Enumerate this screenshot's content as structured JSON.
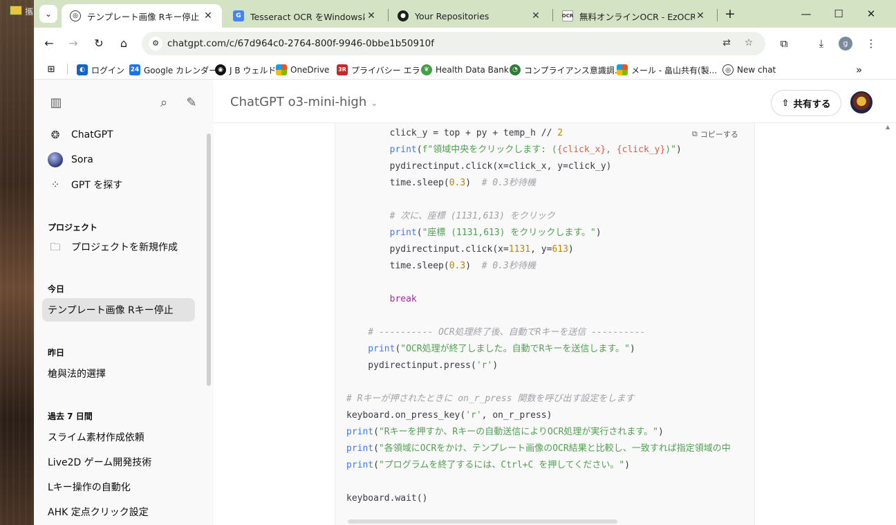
{
  "desktop": {
    "taskbar_label": "攜"
  },
  "tabs": [
    {
      "title": "テンプレート画像 Rキー停止",
      "favicon": "openai-icon",
      "active": true
    },
    {
      "title": "Tesseract OCR をWindowsにインス",
      "favicon": "google-translate-icon",
      "active": false
    },
    {
      "title": "Your Repositories",
      "favicon": "github-icon",
      "active": false
    },
    {
      "title": "無料オンラインOCR - EzOCR",
      "favicon": "ezocr-icon",
      "active": false
    }
  ],
  "toolbar": {
    "url": "chatgpt.com/c/67d964c0-2764-800f-9946-0bbe1b50910f",
    "profile_letter": "g"
  },
  "bookmarks": [
    {
      "label": "ログイン",
      "icon": "globe-icon"
    },
    {
      "label": "Google カレンダー",
      "icon": "calendar-icon",
      "icon_text": "24"
    },
    {
      "label": "J B ウェルド",
      "icon": "jb-icon"
    },
    {
      "label": "OneDrive",
      "icon": "microsoft-icon"
    },
    {
      "label": "プライバシー エラー",
      "icon": "3r-icon",
      "icon_text": "3R"
    },
    {
      "label": "Health Data Bank",
      "icon": "leaf-icon"
    },
    {
      "label": "コンプライアンス意識調...",
      "icon": "survey-icon"
    },
    {
      "label": "メール - 畠山共有(製...",
      "icon": "microsoft-icon"
    },
    {
      "label": "New chat",
      "icon": "openai-icon"
    }
  ],
  "sidebar": {
    "top_items": [
      {
        "label": "ChatGPT",
        "icon": "openai-icon"
      },
      {
        "label": "Sora",
        "icon": "sora-icon"
      },
      {
        "label": "GPT を探す",
        "icon": "grid-icon"
      }
    ],
    "projects_heading": "プロジェクト",
    "new_project_label": "プロジェクトを新規作成",
    "today_heading": "今日",
    "today_items": [
      "テンプレート画像 Rキー停止"
    ],
    "yesterday_heading": "昨日",
    "yesterday_items": [
      "槍與法的選擇"
    ],
    "past7_heading": "過去 7 日間",
    "past7_items": [
      "スライム素材作成依頼",
      "Live2D ゲーム開発技術",
      "Lキー操作の自動化",
      "AHK 定点クリック設定"
    ]
  },
  "header": {
    "model_name": "ChatGPT o3-mini-high",
    "share_label": "共有する"
  },
  "code": {
    "copy_label": "コピーする",
    "lines": [
      [
        [
          "pl",
          "        click_y = top + py + temp_h // "
        ],
        [
          "num",
          "2"
        ]
      ],
      [
        [
          "fn",
          "        print"
        ],
        [
          "pl",
          "("
        ],
        [
          "str",
          "f\"領域中央をクリックします: ("
        ],
        [
          "var",
          "{click_x}"
        ],
        [
          "str",
          ", "
        ],
        [
          "var",
          "{click_y}"
        ],
        [
          "str",
          ")\""
        ],
        [
          "pl",
          ")"
        ]
      ],
      [
        [
          "pl",
          "        pydirectinput.click(x=click_x, y=click_y)"
        ]
      ],
      [
        [
          "pl",
          "        time.sleep("
        ],
        [
          "num",
          "0.3"
        ],
        [
          "pl",
          ")  "
        ],
        [
          "com",
          "# 0.3秒待機"
        ]
      ],
      [],
      [
        [
          "com",
          "        # 次に、座標 (1131,613) をクリック"
        ]
      ],
      [
        [
          "fn",
          "        print"
        ],
        [
          "pl",
          "("
        ],
        [
          "str",
          "\"座標 (1131,613) をクリックします。\""
        ],
        [
          "pl",
          ")"
        ]
      ],
      [
        [
          "pl",
          "        pydirectinput.click(x="
        ],
        [
          "num",
          "1131"
        ],
        [
          "pl",
          ", y="
        ],
        [
          "num",
          "613"
        ],
        [
          "pl",
          ")"
        ]
      ],
      [
        [
          "pl",
          "        time.sleep("
        ],
        [
          "num",
          "0.3"
        ],
        [
          "pl",
          ")  "
        ],
        [
          "com",
          "# 0.3秒待機"
        ]
      ],
      [],
      [
        [
          "kw",
          "        break"
        ]
      ],
      [],
      [
        [
          "com",
          "    # ---------- OCR処理終了後、自動でRキーを送信 ----------"
        ]
      ],
      [
        [
          "fn",
          "    print"
        ],
        [
          "pl",
          "("
        ],
        [
          "str",
          "\"OCR処理が終了しました。自動でRキーを送信します。\""
        ],
        [
          "pl",
          ")"
        ]
      ],
      [
        [
          "pl",
          "    pydirectinput.press("
        ],
        [
          "str",
          "'r'"
        ],
        [
          "pl",
          ")"
        ]
      ],
      [],
      [
        [
          "com",
          "# Rキーが押されたときに on_r_press 関数を呼び出す設定をします"
        ]
      ],
      [
        [
          "pl",
          "keyboard.on_press_key("
        ],
        [
          "str",
          "'r'"
        ],
        [
          "pl",
          ", on_r_press)"
        ]
      ],
      [
        [
          "fn",
          "print"
        ],
        [
          "pl",
          "("
        ],
        [
          "str",
          "\"Rキーを押すか、Rキーの自動送信によりOCR処理が実行されます。\""
        ],
        [
          "pl",
          ")"
        ]
      ],
      [
        [
          "fn",
          "print"
        ],
        [
          "pl",
          "("
        ],
        [
          "str",
          "\"各領域にOCRをかけ、テンプレート画像のOCR結果と比較し、一致すれば指定領域の中"
        ]
      ],
      [
        [
          "fn",
          "print"
        ],
        [
          "pl",
          "("
        ],
        [
          "str",
          "\"プログラムを終了するには、Ctrl+C を押してください。\""
        ],
        [
          "pl",
          ")"
        ]
      ],
      [],
      [
        [
          "pl",
          "keyboard.wait()"
        ]
      ]
    ]
  }
}
